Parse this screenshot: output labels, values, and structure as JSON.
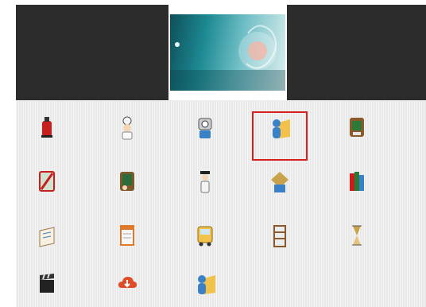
{
  "banner": {
    "title": "",
    "subtitle": ""
  },
  "tiles": [
    {
      "icon": "fire-extinguisher-icon",
      "label": ""
    },
    {
      "icon": "chef-icon",
      "label": ""
    },
    {
      "icon": "robot-icon",
      "label": ""
    },
    {
      "icon": "user-folder-icon",
      "label": ""
    },
    {
      "icon": "green-board-icon",
      "label": ""
    },
    {
      "icon": "pencil-icon",
      "label": ""
    },
    {
      "icon": "no-entry-icon",
      "label": ""
    },
    {
      "icon": "chalkboard-icon",
      "label": ""
    },
    {
      "icon": "teacher-icon",
      "label": ""
    },
    {
      "icon": "diamond-box-icon",
      "label": ""
    },
    {
      "icon": "books-icon",
      "label": ""
    },
    {
      "icon": "classroom-icon",
      "label": ""
    },
    {
      "icon": "notebook-icon",
      "label": ""
    },
    {
      "icon": "calendar-icon",
      "label": ""
    },
    {
      "icon": "bus-icon",
      "label": ""
    },
    {
      "icon": "shelf-icon",
      "label": ""
    },
    {
      "icon": "hourglass-icon",
      "label": ""
    },
    {
      "icon": "group-icon",
      "label": ""
    },
    {
      "icon": "clapperboard-icon",
      "label": ""
    },
    {
      "icon": "cloud-icon",
      "label": ""
    },
    {
      "icon": "user-folder-icon",
      "label": ""
    }
  ],
  "selected_tile": 3,
  "colors": {
    "selection": "#d62020",
    "header": "#2c2c2c"
  }
}
